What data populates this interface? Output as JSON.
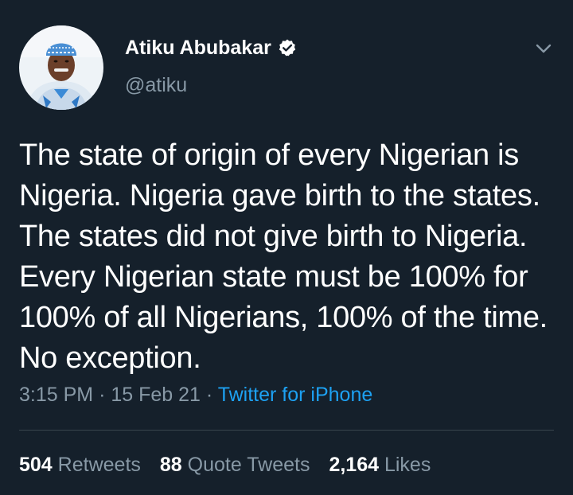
{
  "user": {
    "display_name": "Atiku Abubakar",
    "handle": "@atiku",
    "verified": true
  },
  "tweet": {
    "text": "The state of origin of every Nigerian is Nigeria. Nigeria gave birth to the states. The states did not give birth to Nigeria. Every Nigerian state must be 100% for 100% of all Nigerians, 100% of the time. No exception.",
    "time": "3:15 PM",
    "separator": "·",
    "date": "15 Feb 21",
    "source": "Twitter for iPhone"
  },
  "stats": {
    "retweets_count": "504",
    "retweets_label": "Retweets",
    "quote_tweets_count": "88",
    "quote_tweets_label": "Quote Tweets",
    "likes_count": "2,164",
    "likes_label": "Likes"
  },
  "colors": {
    "background": "#15202b",
    "primary_text": "#ffffff",
    "secondary_text": "#8899a6",
    "accent": "#1da1f2",
    "divider": "#38444d"
  },
  "icons": {
    "verified": "verified-badge-icon",
    "more": "chevron-down-icon"
  }
}
